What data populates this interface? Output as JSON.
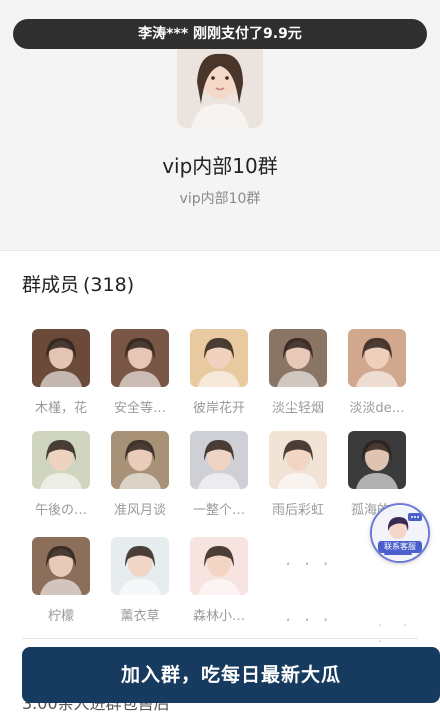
{
  "toast": {
    "text": "李涛*** 刚刚支付了9.9元"
  },
  "group": {
    "title": "vip内部10群",
    "subtitle": "vip内部10群",
    "avatar_icon": "group-avatar-photo"
  },
  "members": {
    "title": "群成员",
    "count": "(318)",
    "items": [
      {
        "name": "木槿，花",
        "avatar": "girl-peace-sign",
        "color": "#6b4a3a"
      },
      {
        "name": "安全等…",
        "avatar": "girl-peace-sign",
        "color": "#7a5646"
      },
      {
        "name": "彼岸花开",
        "avatar": "cartoon-boy",
        "color": "#e8c9a0"
      },
      {
        "name": "淡尘轻烟",
        "avatar": "girl-ghost-face",
        "color": "#8a7463"
      },
      {
        "name": "淡淡de…",
        "avatar": "girl-portrait",
        "color": "#d1a88e"
      },
      {
        "name": "午後の…",
        "avatar": "girl-green-grapes",
        "color": "#cfd5bf"
      },
      {
        "name": "准风月谈",
        "avatar": "girl-ghost-face",
        "color": "#a89277"
      },
      {
        "name": "一整个…",
        "avatar": "girl-phone-selfie",
        "color": "#cfcfd6"
      },
      {
        "name": "雨后彩虹",
        "avatar": "anime-boy",
        "color": "#f1e4d7"
      },
      {
        "name": "孤海的…",
        "avatar": "girl-dark-hair",
        "color": "#3b3b3b"
      },
      {
        "name": "柠檬",
        "avatar": "ultraman-toy",
        "color": "#8c6f5a"
      },
      {
        "name": "薰衣草",
        "avatar": "anime-girl",
        "color": "#e7ecef"
      },
      {
        "name": "森林小…",
        "avatar": "anime-girl-blush",
        "color": "#f7e3df"
      }
    ]
  },
  "join_button": {
    "label": "加入群，吃每日最新大瓜"
  },
  "bottom_text": {
    "text": "3.00亲人进群包售后"
  },
  "customer_service": {
    "label": "联系客服",
    "icon": "customer-service-avatar"
  },
  "colors": {
    "button": "#173b5f",
    "toast": "#2f2f2f",
    "header_bg": "#f4f4f4"
  }
}
